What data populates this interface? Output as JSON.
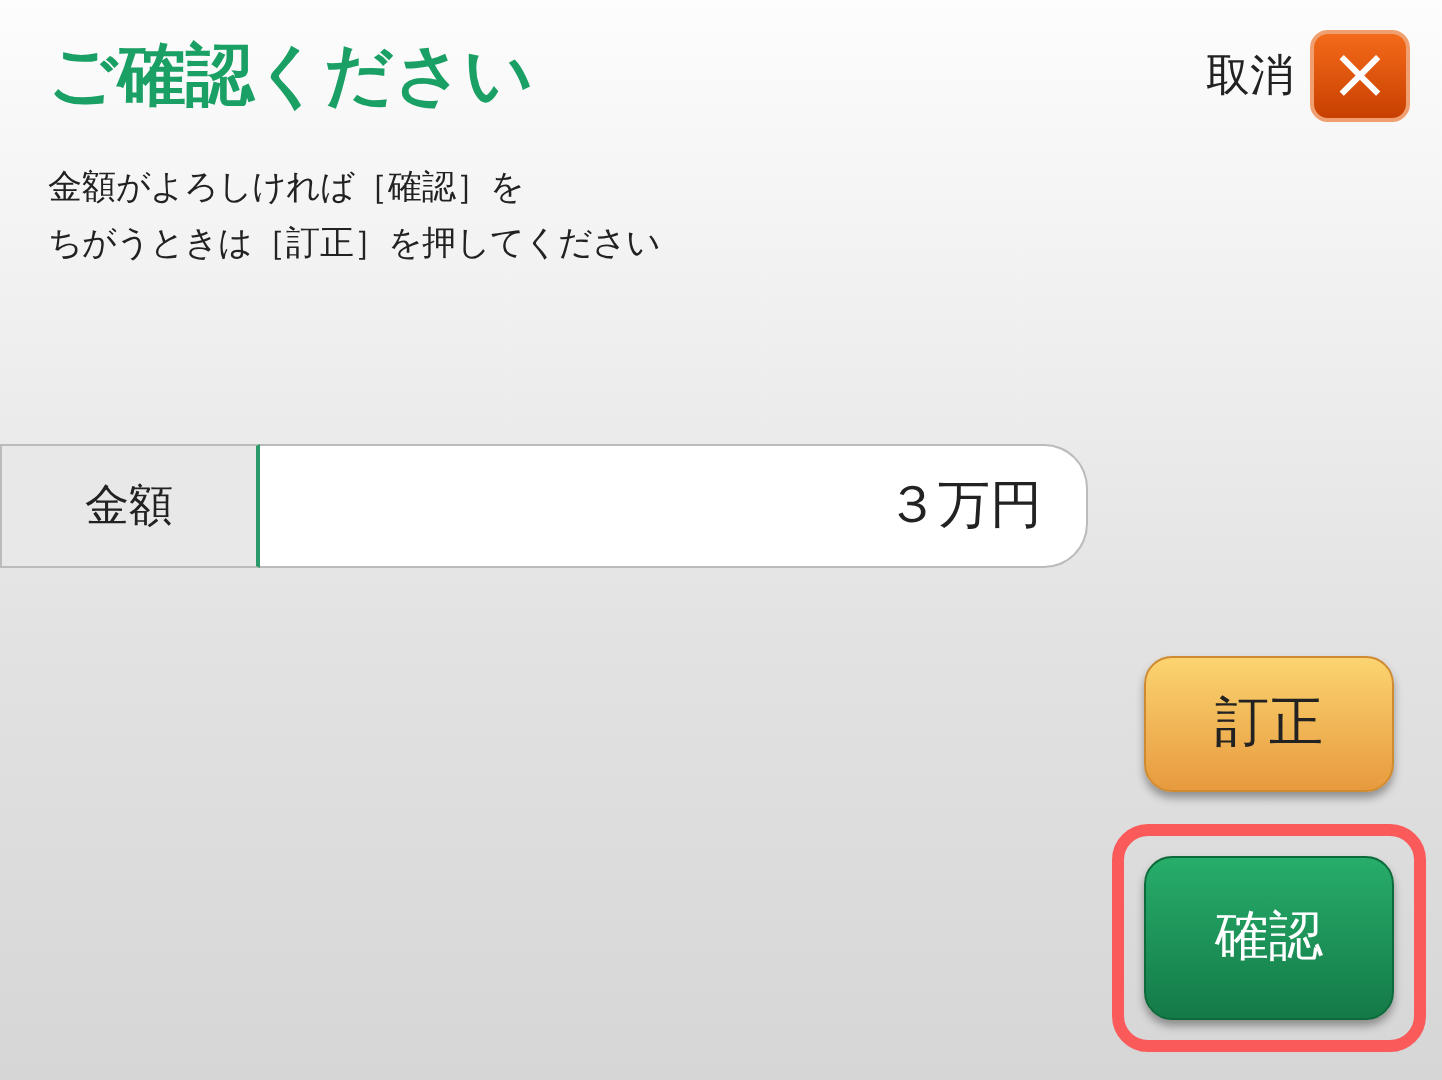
{
  "title": "ご確認ください",
  "cancel": {
    "label": "取消",
    "icon": "×"
  },
  "instructions": [
    "金額がよろしければ［確認］を",
    "ちがうときは［訂正］を押してください"
  ],
  "amount": {
    "label": "金額",
    "value": "３万円"
  },
  "buttons": [
    {
      "kind": "correct",
      "label": "訂正",
      "highlighted": false
    },
    {
      "kind": "confirm",
      "label": "確認",
      "highlighted": true
    }
  ]
}
